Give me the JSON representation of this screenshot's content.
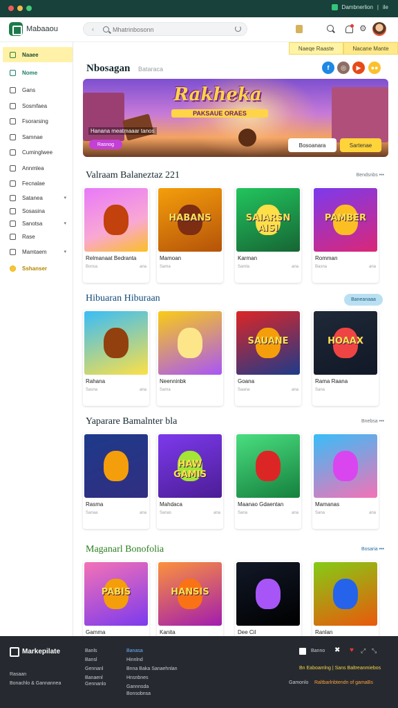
{
  "chrome": {
    "right_text": "Dambnerlion",
    "right_sep": "|",
    "right_extra": "ile"
  },
  "topbar": {
    "title": "Mabaaou",
    "search_placeholder": "Mhatrinbosonn",
    "colors": {
      "brand": "#1c7a4a"
    }
  },
  "sidebar": {
    "items": [
      {
        "label": "Naaee",
        "icon": "home-icon",
        "state": "active"
      },
      {
        "label": "Nome",
        "icon": "house-icon",
        "state": "home"
      },
      {
        "label": "Gans",
        "icon": "gamepad-icon"
      },
      {
        "label": "Sosmfaea",
        "icon": "grid-icon"
      },
      {
        "label": "Fsorarsing",
        "icon": "trending-icon"
      },
      {
        "label": "Samnae",
        "icon": "star-icon"
      },
      {
        "label": "Cuminglwee",
        "icon": "clock-icon"
      },
      {
        "label": "Annmlea",
        "icon": "chart-icon"
      },
      {
        "label": "Fecnalae",
        "icon": "folder-icon"
      },
      {
        "label": "Satanea",
        "icon": "tag-icon",
        "caret": "▾"
      },
      {
        "label": "Sosasina",
        "icon": "users-icon"
      },
      {
        "label": "Sanotsa",
        "icon": "settings-icon",
        "caret": "▾"
      },
      {
        "label": "Rase",
        "icon": "book-icon"
      },
      {
        "label": "Mamtaem",
        "icon": "list-icon",
        "caret": "▾"
      },
      {
        "label": "Sshanser",
        "icon": "coin-icon",
        "state": "yellow"
      }
    ]
  },
  "main": {
    "tabs": [
      "Naeqe Raaste",
      "Nacane Mante"
    ],
    "page_title": "Nbosagan",
    "page_subtitle": "Bataraca",
    "circle_buttons": [
      {
        "icon": "facebook-icon",
        "color": "#1e88e5",
        "label": "f"
      },
      {
        "icon": "camera-icon",
        "color": "#8d6e63",
        "label": "◎"
      },
      {
        "icon": "youtube-icon",
        "color": "#e64a19",
        "label": "▶"
      },
      {
        "icon": "chat-icon",
        "color": "#fbc02d",
        "label": "●●"
      }
    ],
    "hero": {
      "title": "Rakheka",
      "subtitle": "PAKSAUE ORAES",
      "caption": "Hanana meatmaaar tanos",
      "chip": "Rasnog",
      "btn_primary": "Bosoanara",
      "btn_secondary": "Sartenae"
    },
    "sections": [
      {
        "title": "Valraam Balaneztaz 221",
        "link": "Bendsnbs •••",
        "style": "dark",
        "cards": [
          {
            "name": "Relmanaat Bedranta",
            "meta": "Bonsa",
            "right": "ana",
            "word": "",
            "bg": "linear-gradient(160deg,#e879f9,#f9a8d4 60%,#fbbf24)",
            "char": "#c2410c"
          },
          {
            "name": "Mamoan",
            "meta": "Sama",
            "right": "",
            "word": "HABANS",
            "bg": "linear-gradient(160deg,#f59e0b,#b45309)",
            "char": "#7c2d12"
          },
          {
            "name": "Karman",
            "meta": "Samla",
            "right": "ana",
            "word": "SAIARSN AISI",
            "bg": "linear-gradient(160deg,#22c55e,#166534)",
            "char": "#fde047"
          },
          {
            "name": "Romman",
            "meta": "Basna",
            "right": "ana",
            "word": "PAMBER",
            "bg": "linear-gradient(160deg,#7c3aed,#db2777)",
            "char": "#fbbf24"
          }
        ]
      },
      {
        "title": "Hibuaran Hiburaan",
        "link": "Baneanaaa",
        "style": "blue",
        "cards": [
          {
            "name": "Rahana",
            "meta": "Sasna",
            "right": "ana",
            "word": "",
            "bg": "linear-gradient(160deg,#38bdf8,#fde047)",
            "char": "#92400e"
          },
          {
            "name": "Neenninbk",
            "meta": "Sama",
            "right": "",
            "word": "",
            "bg": "linear-gradient(160deg,#facc15,#a855f7)",
            "char": "#fde68a"
          },
          {
            "name": "Goana",
            "meta": "Saana",
            "right": "ana",
            "word": "SAUANE",
            "bg": "linear-gradient(160deg,#dc2626,#1e3a8a)",
            "char": "#f59e0b"
          },
          {
            "name": "Rama Raana",
            "meta": "Sana",
            "right": "",
            "word": "HOAAX",
            "bg": "linear-gradient(160deg,#1f2937,#111827)",
            "char": "#ef4444"
          }
        ]
      },
      {
        "title": "Yaparare Bamalnter bla",
        "link": "Bnebsa •••",
        "style": "dark",
        "cards": [
          {
            "name": "Rasma",
            "meta": "Sanaa",
            "right": "ana",
            "word": "",
            "bg": "linear-gradient(160deg,#1e3a8a,#312e81)",
            "char": "#f59e0b"
          },
          {
            "name": "Mahdaca",
            "meta": "Sanas",
            "right": "ana",
            "word": "HAW GAMIS",
            "bg": "linear-gradient(160deg,#7c3aed,#4c1d95)",
            "char": "#a3e635"
          },
          {
            "name": "Maanao Gdaentan",
            "meta": "Sana",
            "right": "ana",
            "word": "",
            "bg": "linear-gradient(160deg,#4ade80,#15803d)",
            "char": "#dc2626"
          },
          {
            "name": "Mamanas",
            "meta": "Sana",
            "right": "ana",
            "word": "",
            "bg": "linear-gradient(160deg,#38bdf8,#f472b6)",
            "char": "#d946ef"
          }
        ]
      },
      {
        "title": "Maganarl Bonofolia",
        "link": "Bosaria •••",
        "style": "green",
        "cards": [
          {
            "name": "Gamma",
            "meta": "",
            "right": "",
            "word": "PABIS",
            "bg": "linear-gradient(160deg,#f472b6,#7c3aed)",
            "char": "#f59e0b"
          },
          {
            "name": "Kanita",
            "meta": "",
            "right": "",
            "word": "HANSIS",
            "bg": "linear-gradient(160deg,#fb923c,#a21caf)",
            "char": "#f97316"
          },
          {
            "name": "Dee  Cil",
            "meta": "",
            "right": "",
            "word": "",
            "bg": "linear-gradient(160deg,#111827,#000000)",
            "char": "#a855f7"
          },
          {
            "name": "Ranlan",
            "meta": "",
            "right": "",
            "word": "",
            "bg": "linear-gradient(160deg,#84cc16,#ea580c)",
            "char": "#2563eb"
          }
        ]
      }
    ]
  },
  "footer": {
    "brand": "Markepilate",
    "left_lines": [
      "Rasaan",
      "Bonachlo & Gannannea"
    ],
    "col1": [
      "Banls",
      "Bansl",
      "Gennanl",
      "Banaenl",
      "Gennanlo"
    ],
    "col2": [
      "Banasa",
      "Hinnlnd",
      "Bnna Baka Sanaehnlan",
      "Hnsnbnes",
      "Gannnsda",
      "Bonsobnsa"
    ],
    "right_top": "Banno",
    "right_mid": "Bn Eaboamlng | Sans Baltreanmiebos",
    "right_bottom_label": "Gamonlo",
    "right_bottom_value": "Raltbarlnbtendn of gamaBs"
  }
}
